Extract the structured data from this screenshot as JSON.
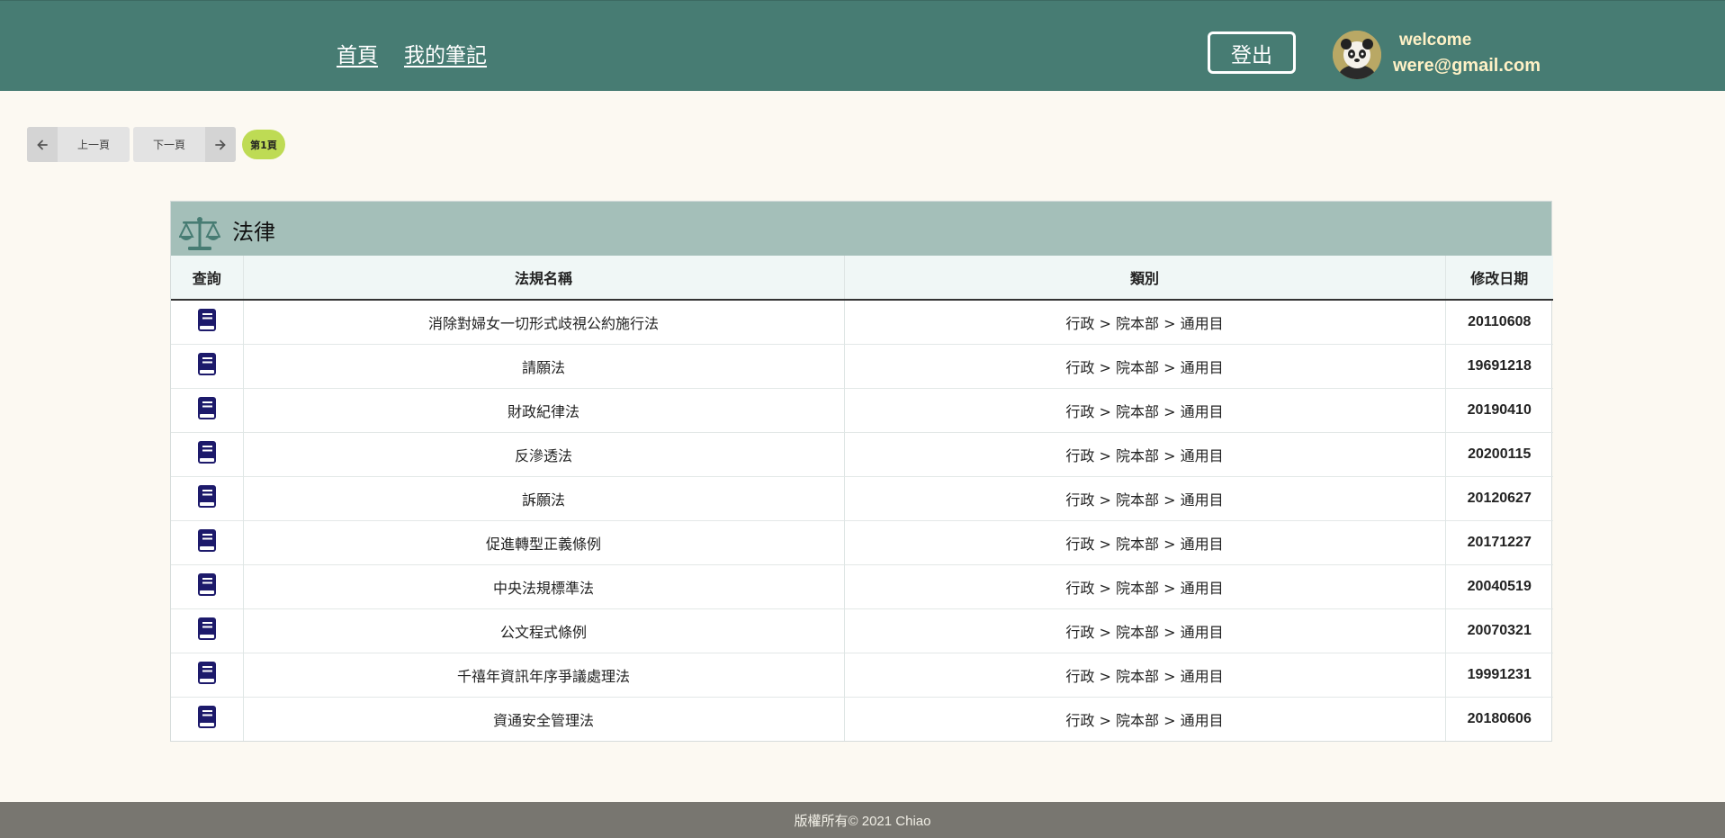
{
  "header": {
    "nav": {
      "home": "首頁",
      "notes": "我的筆記"
    },
    "logout_label": "登出",
    "welcome": "welcome",
    "email": "were@gmail.com",
    "bg_color": "#477c73"
  },
  "pagination": {
    "prev_label": "上一頁",
    "next_label": "下一頁",
    "current_label": "第1頁",
    "prev_icon": "arrow-left-icon",
    "next_icon": "arrow-right-icon"
  },
  "section": {
    "title": "法律",
    "icon": "scale-icon"
  },
  "table": {
    "headers": [
      "查詢",
      "法規名稱",
      "類別",
      "修改日期"
    ],
    "rows": [
      {
        "name": "消除對婦女一切形式歧視公約施行法",
        "category": "行政 > 院本部 > 通用目",
        "date": "20110608"
      },
      {
        "name": "請願法",
        "category": "行政 > 院本部 > 通用目",
        "date": "19691218"
      },
      {
        "name": "財政紀律法",
        "category": "行政 > 院本部 > 通用目",
        "date": "20190410"
      },
      {
        "name": "反滲透法",
        "category": "行政 > 院本部 > 通用目",
        "date": "20200115"
      },
      {
        "name": "訴願法",
        "category": "行政 > 院本部 > 通用目",
        "date": "20120627"
      },
      {
        "name": "促進轉型正義條例",
        "category": "行政 > 院本部 > 通用目",
        "date": "20171227"
      },
      {
        "name": "中央法規標準法",
        "category": "行政 > 院本部 > 通用目",
        "date": "20040519"
      },
      {
        "name": "公文程式條例",
        "category": "行政 > 院本部 > 通用目",
        "date": "20070321"
      },
      {
        "name": "千禧年資訊年序爭議處理法",
        "category": "行政 > 院本部 > 通用目",
        "date": "19991231"
      },
      {
        "name": "資通安全管理法",
        "category": "行政 > 院本部 > 通用目",
        "date": "20180606"
      }
    ],
    "row_icon": "book-icon"
  },
  "footer": {
    "text": "版權所有© 2021 Chiao"
  }
}
